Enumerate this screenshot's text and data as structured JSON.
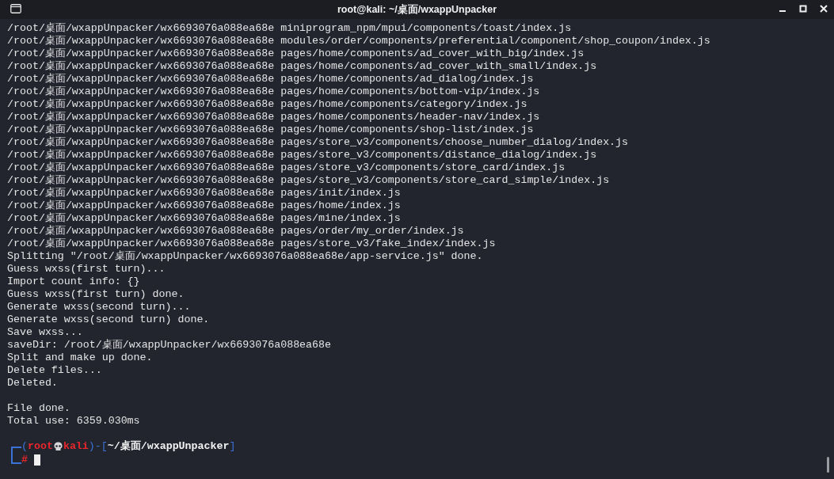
{
  "window": {
    "title": "root@kali: ~/桌面/wxappUnpacker"
  },
  "output": [
    {
      "lines": [
        "/root/桌面/wxappUnpacker/wx6693076a088ea68e miniprogram_npm/mpui/components/toast/index.js",
        "/root/桌面/wxappUnpacker/wx6693076a088ea68e modules/order/components/preferential/component/shop_coupon/index.js",
        "/root/桌面/wxappUnpacker/wx6693076a088ea68e pages/home/components/ad_cover_with_big/index.js",
        "/root/桌面/wxappUnpacker/wx6693076a088ea68e pages/home/components/ad_cover_with_small/index.js",
        "/root/桌面/wxappUnpacker/wx6693076a088ea68e pages/home/components/ad_dialog/index.js",
        "/root/桌面/wxappUnpacker/wx6693076a088ea68e pages/home/components/bottom-vip/index.js",
        "/root/桌面/wxappUnpacker/wx6693076a088ea68e pages/home/components/category/index.js",
        "/root/桌面/wxappUnpacker/wx6693076a088ea68e pages/home/components/header-nav/index.js",
        "/root/桌面/wxappUnpacker/wx6693076a088ea68e pages/home/components/shop-list/index.js",
        "/root/桌面/wxappUnpacker/wx6693076a088ea68e pages/store_v3/components/choose_number_dialog/index.js",
        "/root/桌面/wxappUnpacker/wx6693076a088ea68e pages/store_v3/components/distance_dialog/index.js",
        "/root/桌面/wxappUnpacker/wx6693076a088ea68e pages/store_v3/components/store_card/index.js",
        "/root/桌面/wxappUnpacker/wx6693076a088ea68e pages/store_v3/components/store_card_simple/index.js",
        "/root/桌面/wxappUnpacker/wx6693076a088ea68e pages/init/index.js",
        "/root/桌面/wxappUnpacker/wx6693076a088ea68e pages/home/index.js",
        "/root/桌面/wxappUnpacker/wx6693076a088ea68e pages/mine/index.js",
        "/root/桌面/wxappUnpacker/wx6693076a088ea68e pages/order/my_order/index.js",
        "/root/桌面/wxappUnpacker/wx6693076a088ea68e pages/store_v3/fake_index/index.js",
        "Splitting \"/root/桌面/wxappUnpacker/wx6693076a088ea68e/app-service.js\" done.",
        "Guess wxss(first turn)...",
        "Import count info: {}",
        "Guess wxss(first turn) done.",
        "Generate wxss(second turn)...",
        "Generate wxss(second turn) done.",
        "Save wxss...",
        "saveDir: /root/桌面/wxappUnpacker/wx6693076a088ea68e",
        "Split and make up done.",
        "Delete files...",
        "Deleted."
      ]
    },
    {
      "lines": [
        "File done.",
        "Total use: 6359.030ms"
      ]
    }
  ],
  "prompt": {
    "open": "(",
    "user": "root",
    "host": "kali",
    "mid": ")-[",
    "path": "~/桌面/wxappUnpacker",
    "close": "]",
    "symbol": "#"
  }
}
